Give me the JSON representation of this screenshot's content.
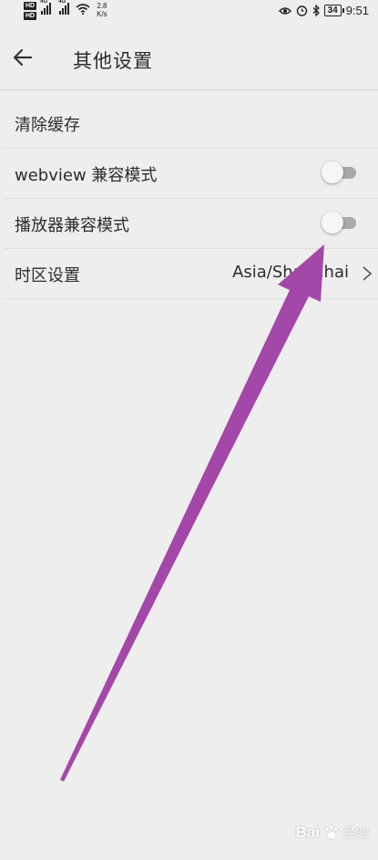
{
  "status_bar": {
    "hd1": "HD",
    "hd2": "HD",
    "net1": "4G",
    "net2": "4G",
    "speed_value": "2.8",
    "speed_unit": "K/s",
    "battery": "34",
    "time": "9:51"
  },
  "header": {
    "title": "其他设置"
  },
  "settings": {
    "clear_cache": "清除缓存",
    "webview_compat": "webview 兼容模式",
    "player_compat": "播放器兼容模式",
    "timezone_label": "时区设置",
    "timezone_value": "Asia/Shanghai"
  },
  "toggles": {
    "webview_compat_on": false,
    "player_compat_on": false
  },
  "annotation_color": "#a347a8",
  "watermark": {
    "brand": "Bai",
    "suffix": "经验"
  }
}
